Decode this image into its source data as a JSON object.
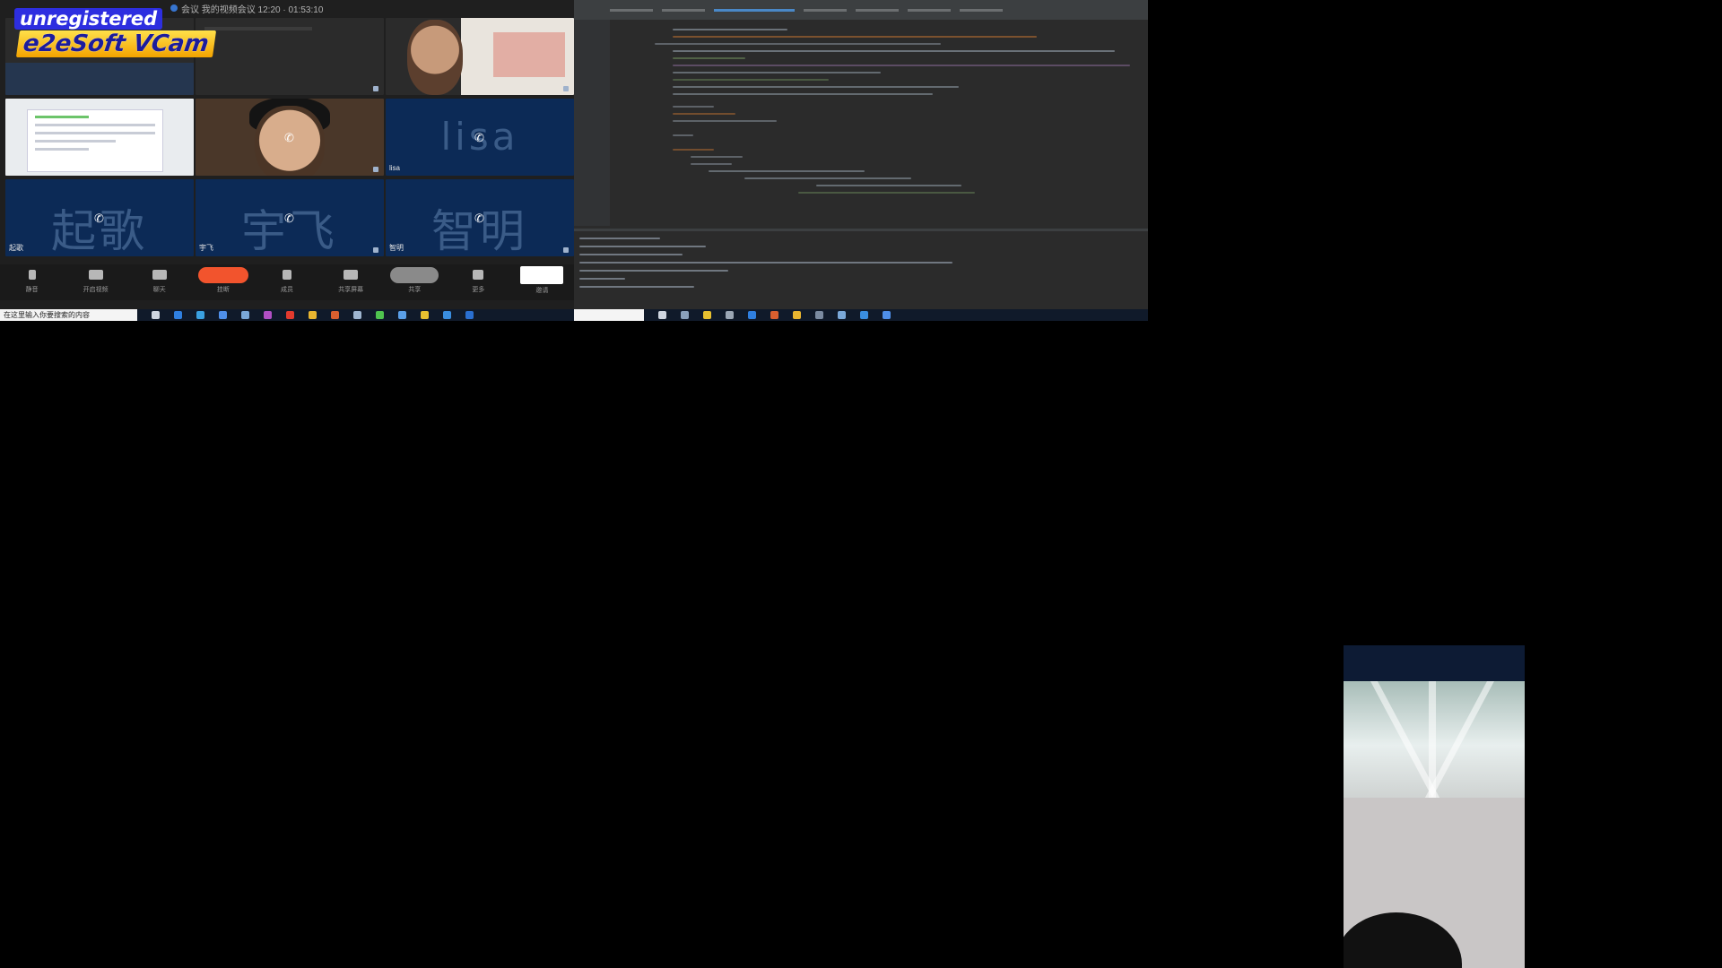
{
  "watermark": {
    "line1": "unregistered",
    "line2": "e2eSoft VCam"
  },
  "meeting": {
    "title": "会议 我的视频会议 12:20 · 01:53:10",
    "tiles": [
      {
        "name": "",
        "kind": "screen"
      },
      {
        "name": "",
        "kind": "camera"
      },
      {
        "name": "",
        "kind": "camera"
      },
      {
        "name": "",
        "kind": "screen"
      },
      {
        "name": "",
        "kind": "camera"
      },
      {
        "name": "lisa",
        "kind": "audio"
      },
      {
        "name": "起歌",
        "kind": "audio"
      },
      {
        "name": "宇飞",
        "kind": "audio"
      },
      {
        "name": "智明",
        "kind": "audio"
      }
    ]
  },
  "toolbar": {
    "items": [
      {
        "label": "静音",
        "icon": "microphone-icon"
      },
      {
        "label": "开启视频",
        "icon": "camera-icon"
      },
      {
        "label": "聊天",
        "icon": "chat-icon"
      },
      {
        "label": "挂断",
        "icon": "hang-up-icon"
      },
      {
        "label": "成员",
        "icon": "people-icon"
      },
      {
        "label": "共享屏幕",
        "icon": "share-screen-icon"
      },
      {
        "label": "共享",
        "icon": "share-icon"
      },
      {
        "label": "更多",
        "icon": "more-icon"
      },
      {
        "label": "邀请",
        "icon": "invite-icon"
      }
    ]
  },
  "taskbar": {
    "search_text": "在这里输入你要搜索的内容"
  },
  "colors": {
    "hangup": "#f2542d",
    "tile_blue": "#0c2a56",
    "ide_bg": "#2b2b2b",
    "watermark_blue": "#2d2ee0",
    "watermark_yellow": "#f3a300"
  }
}
